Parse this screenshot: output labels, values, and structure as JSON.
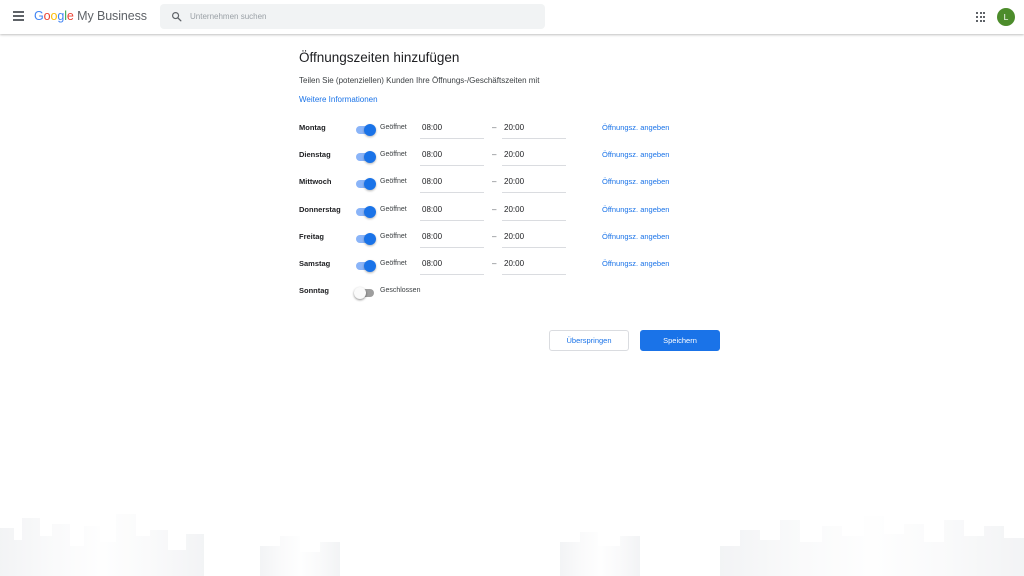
{
  "header": {
    "logo_google": "Google",
    "logo_product": "My Business",
    "search_placeholder": "Unternehmen suchen",
    "avatar_initial": "L"
  },
  "page": {
    "title": "Öffnungszeiten hinzufügen",
    "subtitle": "Teilen Sie (potenziellen) Kunden Ihre Öffnungs-/Geschäftszeiten mit",
    "more_info": "Weitere Informationen"
  },
  "days": [
    {
      "name": "Montag",
      "status": "Geöffnet",
      "open": "08:00",
      "separator": "–",
      "close": "20:00",
      "link": "Öffnungsz. angeben",
      "enabled": true
    },
    {
      "name": "Dienstag",
      "status": "Geöffnet",
      "open": "08:00",
      "separator": "–",
      "close": "20:00",
      "link": "Öffnungsz. angeben",
      "enabled": true
    },
    {
      "name": "Mittwoch",
      "status": "Geöffnet",
      "open": "08:00",
      "separator": "–",
      "close": "20:00",
      "link": "Öffnungsz. angeben",
      "enabled": true
    },
    {
      "name": "Donnerstag",
      "status": "Geöffnet",
      "open": "08:00",
      "separator": "–",
      "close": "20:00",
      "link": "Öffnungsz. angeben",
      "enabled": true
    },
    {
      "name": "Freitag",
      "status": "Geöffnet",
      "open": "08:00",
      "separator": "–",
      "close": "20:00",
      "link": "Öffnungsz. angeben",
      "enabled": true
    },
    {
      "name": "Samstag",
      "status": "Geöffnet",
      "open": "08:00",
      "separator": "–",
      "close": "20:00",
      "link": "Öffnungsz. angeben",
      "enabled": true
    },
    {
      "name": "Sonntag",
      "status": "Geschlossen",
      "enabled": false
    }
  ],
  "actions": {
    "skip_label": "Überspringen",
    "save_label": "Speichern"
  },
  "colors": {
    "accent": "#1a73e8",
    "avatar": "#4c8c2b"
  }
}
